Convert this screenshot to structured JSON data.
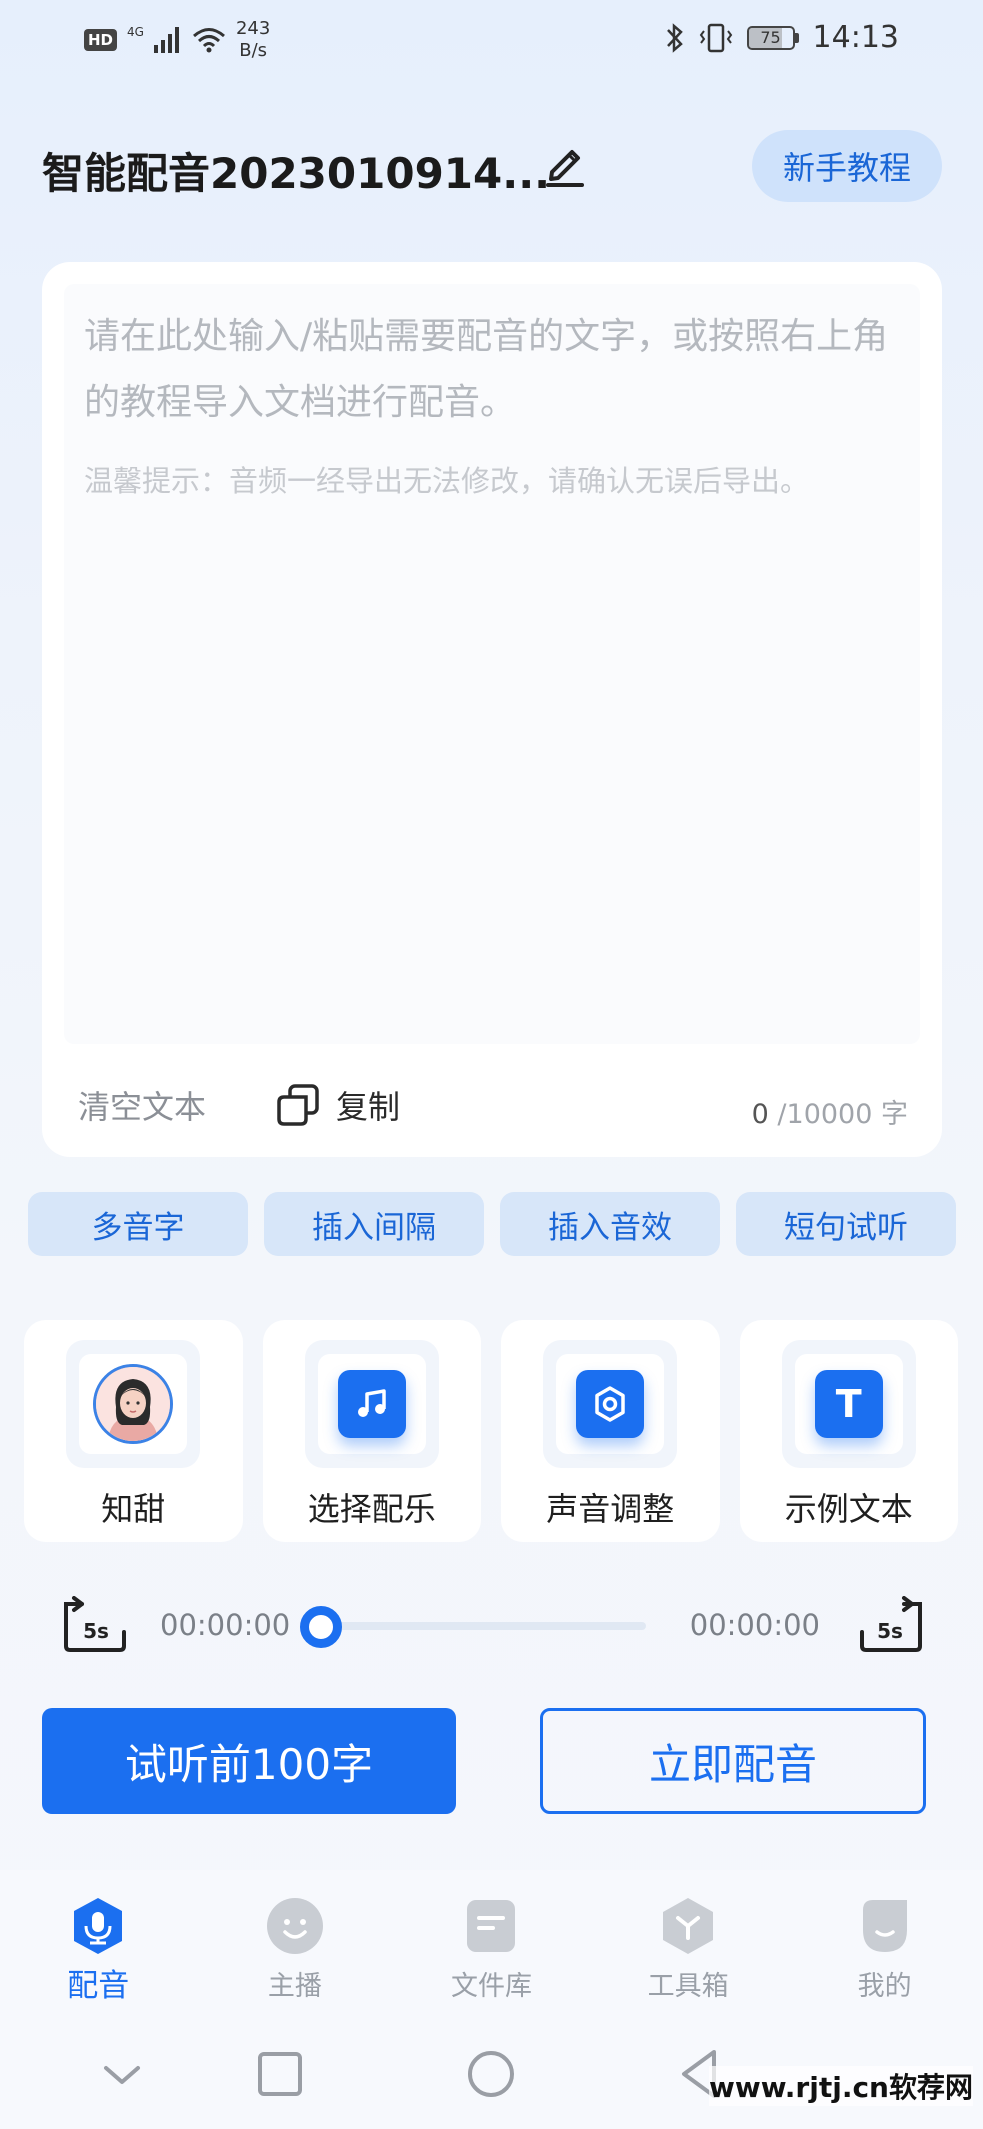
{
  "status_bar": {
    "hd": "HD",
    "network": "4G",
    "speed_value": "243",
    "speed_unit": "B/s",
    "battery": "75",
    "battery_level_pct": 75,
    "time": "14:13"
  },
  "header": {
    "title": "智能配音2023010914...",
    "tutorial_label": "新手教程"
  },
  "editor": {
    "placeholder": "请在此处输入/粘贴需要配音的文字，或按照右上角的教程导入文档进行配音。",
    "hint": "温馨提示：音频一经导出无法修改，请确认无误后导出。",
    "clear_label": "清空文本",
    "copy_label": "复制",
    "count_current": "0",
    "count_max": " /10000 字"
  },
  "chips": [
    {
      "label": "多音字"
    },
    {
      "label": "插入间隔"
    },
    {
      "label": "插入音效"
    },
    {
      "label": "短句试听"
    }
  ],
  "tools": [
    {
      "label": "知甜",
      "icon": "avatar"
    },
    {
      "label": "选择配乐",
      "icon": "music-note-icon"
    },
    {
      "label": "声音调整",
      "icon": "settings-icon"
    },
    {
      "label": "示例文本",
      "icon": "text-icon",
      "glyph": "T"
    }
  ],
  "player": {
    "rewind_label": "5s",
    "forward_label": "5s",
    "current_time": "00:00:00",
    "total_time": "00:00:00",
    "progress_pct": 0
  },
  "actions": {
    "preview_label": "试听前100字",
    "dub_label": "立即配音"
  },
  "nav": {
    "items": [
      {
        "label": "配音",
        "icon": "microphone-icon",
        "active": true
      },
      {
        "label": "主播",
        "icon": "face-icon",
        "active": false
      },
      {
        "label": "文件库",
        "icon": "folder-icon",
        "active": false
      },
      {
        "label": "工具箱",
        "icon": "toolbox-icon",
        "active": false
      },
      {
        "label": "我的",
        "icon": "profile-icon",
        "active": false
      }
    ]
  },
  "watermark": "www.rjtj.cn软荐网",
  "colors": {
    "accent": "#1b6ff0",
    "chip_bg": "#d7e6f9",
    "tutorial_bg": "#cfe2fb",
    "placeholder": "#b4b8be"
  }
}
